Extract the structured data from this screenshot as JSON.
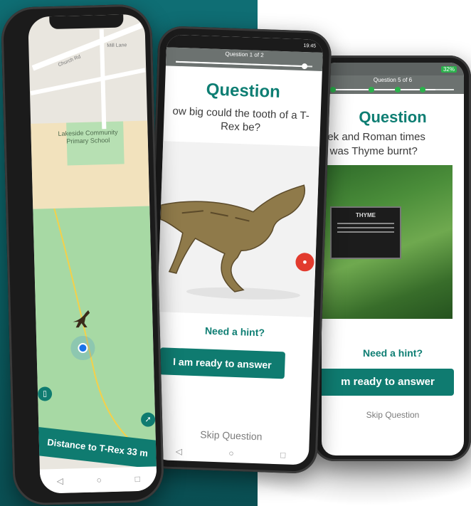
{
  "map_phone": {
    "place_label": "Lakeside Community Primary School",
    "distance_text": "Distance to T-Rex 33 m",
    "street_labels": [
      "Church Rd",
      "Mill Lane"
    ],
    "nav_icons": [
      "back-icon",
      "home-icon",
      "recents-icon"
    ]
  },
  "trex_phone": {
    "status_time": "19:45",
    "progress_label": "Question 1 of 2",
    "progress_fraction": 0.92,
    "title": "Question",
    "question": "ow big could the tooth of a T-Rex be?",
    "hint": "Need a hint?",
    "answer_button": "I am ready to answer",
    "skip": "Skip Question",
    "ar_icon": "video-camera-icon"
  },
  "thyme_phone": {
    "status_battery": "32%",
    "progress_label": "Question 5 of 6",
    "title": "Question",
    "question_line1": "eek and Roman times",
    "question_line2": "y was Thyme burnt?",
    "sign_title": "THYME",
    "hint": "Need a hint?",
    "answer_button": "m ready to answer",
    "skip": "Skip Question"
  },
  "colors": {
    "teal_brand": "#0f7b70",
    "teal_background": "#0f6e74",
    "progress_gray": "#6c7270"
  }
}
